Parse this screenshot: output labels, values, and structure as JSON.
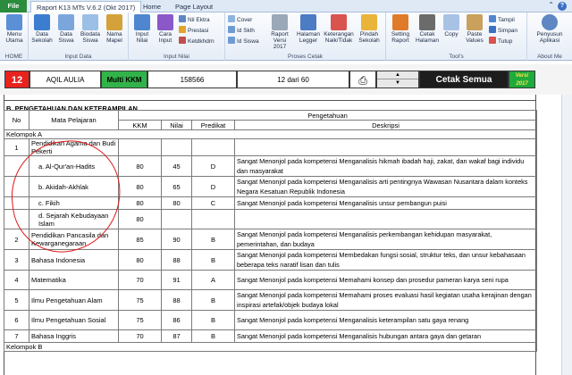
{
  "window": {
    "title": "Raport K13 MTs V.6.2 (Okt 2017)"
  },
  "tabs": [
    "File",
    "Raport K13 MTs V.6.2 (Okt 2017)",
    "Home",
    "Page Layout"
  ],
  "ribbon": {
    "groups": [
      {
        "label": "HOME",
        "buttons": [
          {
            "label": "Menu Utama",
            "icon": "home-icon"
          }
        ]
      },
      {
        "label": "Input Data",
        "buttons": [
          {
            "label": "Data Sekolah",
            "icon": "database-icon"
          },
          {
            "label": "Data Siswa",
            "icon": "table-icon"
          },
          {
            "label": "Biodata Siswa",
            "icon": "grid-icon"
          },
          {
            "label": "Nama Mapel",
            "icon": "book-icon"
          }
        ]
      },
      {
        "label": "Input Nilai",
        "buttons": [
          {
            "label": "Input Nilai",
            "icon": "document-icon"
          },
          {
            "label": "Cara Input",
            "icon": "question-icon"
          }
        ],
        "small": [
          "Nil Ektra",
          "Prestasi",
          "Ketdkhdrn"
        ]
      },
      {
        "label": "Proses Cetak",
        "small": [
          "Cover",
          "Id Sklh",
          "Id Siswa"
        ],
        "buttons": [
          {
            "label": "Raport Versi 2017",
            "icon": "report-icon"
          },
          {
            "label": "Halaman Legger",
            "icon": "ledger-icon"
          },
          {
            "label": "Keterangan Naik/Tidak",
            "icon": "chart-icon"
          },
          {
            "label": "Pindah Sekolah",
            "icon": "folder-icon"
          }
        ]
      },
      {
        "label": "Tool's",
        "buttons": [
          {
            "label": "Setting Raport",
            "icon": "settings-icon"
          },
          {
            "label": "Cetak Halaman",
            "icon": "print-icon"
          },
          {
            "label": "Copy",
            "icon": "copy-icon"
          },
          {
            "label": "Paste Values",
            "icon": "paste-icon"
          }
        ],
        "small": [
          "Tampil",
          "Simpan",
          "Tutup"
        ]
      },
      {
        "label": "About Me",
        "buttons": [
          {
            "label": "Penyusun Aplikasi",
            "icon": "user-icon"
          }
        ]
      }
    ]
  },
  "info": {
    "number": "12",
    "name": "AQIL AULIA",
    "kkm_label": "Multi KKM",
    "nis": "158566",
    "page": "12 dari 60",
    "print_button": "Cetak Semua",
    "version": "Versi 2017"
  },
  "sheet": {
    "section_title": "B. PENGETAHUAN DAN KETERAMPILAN",
    "headers": {
      "no": "No",
      "mapel": "Mata Pelajaran",
      "pengetahuan": "Pengetahuan",
      "kkm": "KKM",
      "nilai": "Nilai",
      "predikat": "Predikat",
      "deskripsi": "Deskripsi"
    },
    "group_a": "Kelompok A",
    "group_b": "Kelompok B",
    "rows": [
      {
        "no": "1",
        "mapel": "Pendidikan Agama dan Budi Pekerti",
        "kkm": "",
        "nilai": "",
        "predikat": "",
        "desc": ""
      },
      {
        "no": "",
        "mapel": "a. Al-Qur'an-Hadits",
        "kkm": "80",
        "nilai": "45",
        "predikat": "D",
        "desc": "Sangat Menonjol pada kompetensi Menganalisis hikmah ibadah haji, zakat, dan wakaf bagi individu dan masyarakat"
      },
      {
        "no": "",
        "mapel": "b. Akidah-Akhlak",
        "kkm": "80",
        "nilai": "65",
        "predikat": "D",
        "desc": "Sangat Menonjol pada kompetensi Menganalisis arti pentingnya Wawasan Nusantara dalam konteks Negara Kesatuan Republik Indonesia"
      },
      {
        "no": "",
        "mapel": "c. Fikih",
        "kkm": "80",
        "nilai": "80",
        "predikat": "C",
        "desc": "Sangat Menonjol pada kompetensi  Menganalisis unsur pembangun puisi"
      },
      {
        "no": "",
        "mapel": "d. Sejarah Kebudayaan Islam",
        "kkm": "80",
        "nilai": "",
        "predikat": "",
        "desc": ""
      },
      {
        "no": "2",
        "mapel": "Pendidikan Pancasila dan Kewarganegaraan",
        "kkm": "85",
        "nilai": "90",
        "predikat": "B",
        "desc": "Sangat Menonjol pada kompetensi Menganalisis perkembangan kehidupan masyarakat, pemerintahan, dan budaya"
      },
      {
        "no": "3",
        "mapel": "Bahasa Indonesia",
        "kkm": "80",
        "nilai": "88",
        "predikat": "B",
        "desc": "Sangat Menonjol pada kompetensi Membedakan fungsi sosial, struktur teks, dan unsur kebahasaan beberapa teks naratif lisan dan tulis"
      },
      {
        "no": "4",
        "mapel": "Matematika",
        "kkm": "70",
        "nilai": "91",
        "predikat": "A",
        "desc": "Sangat Menonjol pada kompetensi Memahami konsep dan prosedur pameran karya seni rupa"
      },
      {
        "no": "5",
        "mapel": "Ilmu Pengetahuan Alam",
        "kkm": "75",
        "nilai": "88",
        "predikat": "B",
        "desc": "Sangat Menonjol pada kompetensi Memahami proses evaluasi hasil kegiatan usaha kerajinan dengan inspirasi artefak/objek budaya lokal"
      },
      {
        "no": "6",
        "mapel": "Ilmu Pengetahuan Sosial",
        "kkm": "75",
        "nilai": "86",
        "predikat": "B",
        "desc": "Sangat Menonjol pada kompetensi Menganalisis keterampilan satu gaya renang"
      },
      {
        "no": "7",
        "mapel": "Bahasa Inggris",
        "kkm": "70",
        "nilai": "87",
        "predikat": "B",
        "desc": "Sangat Menonjol pada kompetensi Menganalisis hubungan antara gaya dan getaran"
      }
    ]
  },
  "colors": {
    "number_bg": "#e8231e",
    "kkm_bg": "#32b34a",
    "cetak_bg": "#1d1d1d",
    "annotation": "#e01818"
  }
}
